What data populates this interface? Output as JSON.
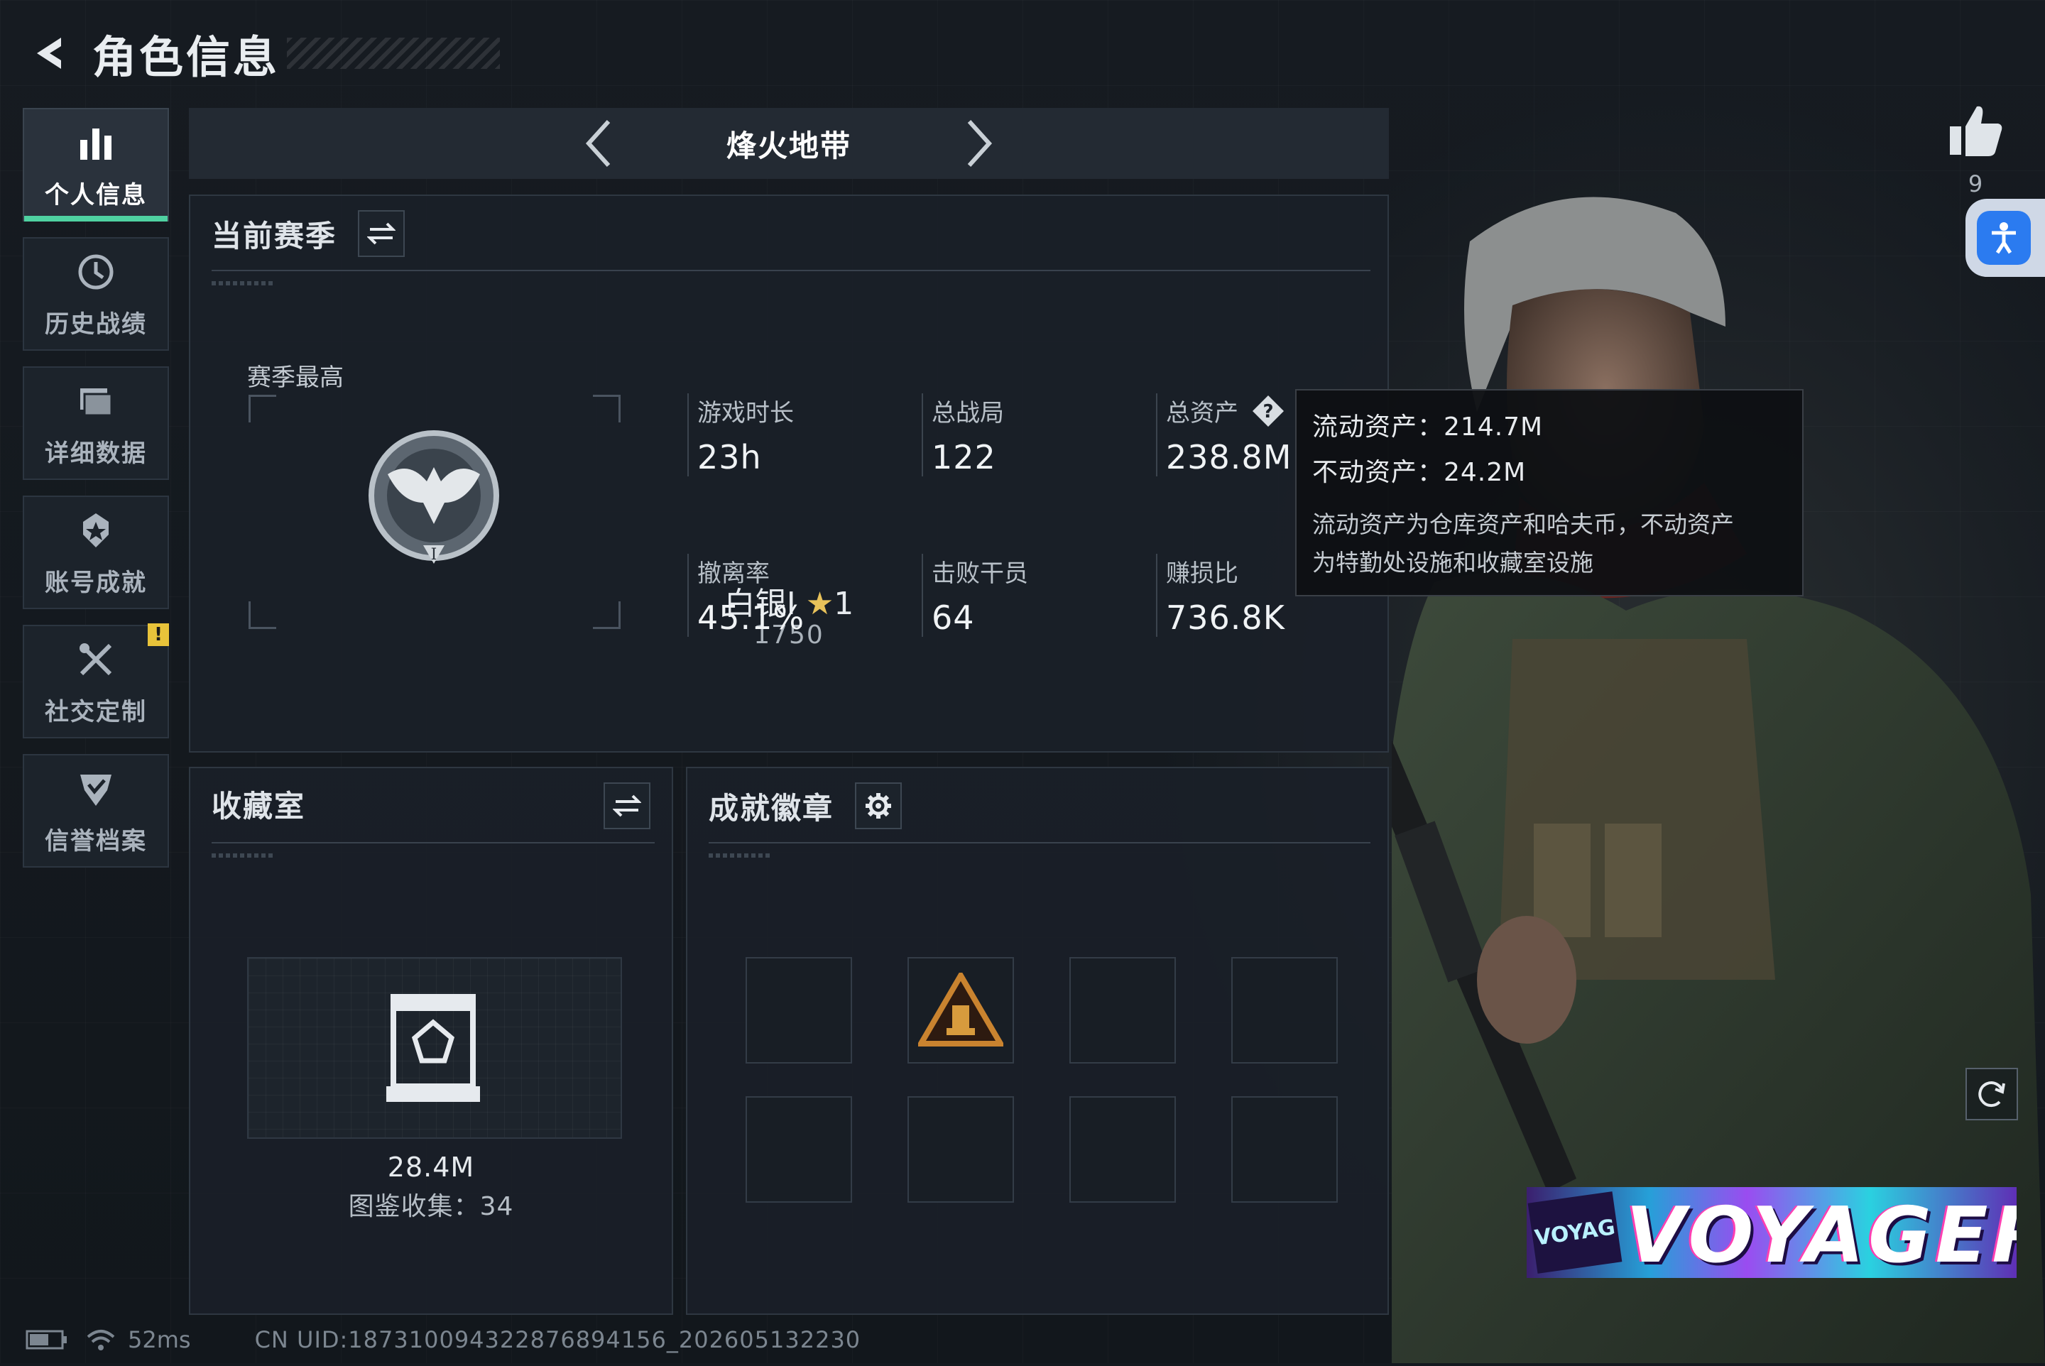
{
  "header": {
    "title": "角色信息"
  },
  "sidebar": {
    "items": [
      {
        "label": "个人信息",
        "icon": "bar-chart-icon",
        "active": true
      },
      {
        "label": "历史战绩",
        "icon": "clock-history-icon"
      },
      {
        "label": "详细数据",
        "icon": "folder-icon"
      },
      {
        "label": "账号成就",
        "icon": "achievement-icon"
      },
      {
        "label": "社交定制",
        "icon": "tools-icon",
        "badge": "!"
      },
      {
        "label": "信誉档案",
        "icon": "shield-check-icon"
      }
    ]
  },
  "mode": {
    "title": "烽火地带"
  },
  "season": {
    "title": "当前赛季",
    "best_label": "赛季最高",
    "rank_name": "白银I",
    "rank_stars": "1",
    "rank_score": "1750",
    "stats": [
      {
        "label": "游戏时长",
        "value": "23h"
      },
      {
        "label": "总战局",
        "value": "122"
      },
      {
        "label": "总资产",
        "value": "238.8M",
        "has_help": true
      },
      {
        "label": "撤离率",
        "value": "45.1%"
      },
      {
        "label": "击败干员",
        "value": "64"
      },
      {
        "label": "赚损比",
        "value": "736.8K"
      }
    ]
  },
  "tooltip": {
    "liquid": "流动资产：214.7M",
    "fixed": "不动资产：24.2M",
    "desc_line1": "流动资产为仓库资产和哈夫币，不动资产",
    "desc_line2": "为特勤处设施和收藏室设施"
  },
  "collection": {
    "title": "收藏室",
    "value": "28.4M",
    "count": "图鉴收集：34"
  },
  "badges": {
    "title": "成就徽章"
  },
  "right": {
    "like_count": "9",
    "banner_text": "VOYAGER",
    "banner_small": "VOYAG"
  },
  "status": {
    "ping": "52ms",
    "uid": "CN UID:18731009432287689​4156_202605132230"
  },
  "colors": {
    "accent_green": "#4fd1a1",
    "warn_yellow": "#e8c33a",
    "access_blue": "#2b7bf0"
  }
}
